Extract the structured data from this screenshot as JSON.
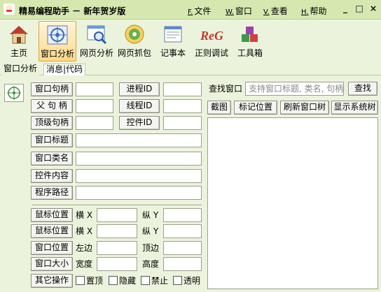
{
  "window": {
    "title": "精易编程助手 － 新年贺岁版",
    "menus": [
      {
        "key": "F.",
        "label": "文件"
      },
      {
        "key": "W.",
        "label": "窗口"
      },
      {
        "key": "V.",
        "label": "查看"
      },
      {
        "key": "H.",
        "label": "帮助"
      }
    ],
    "controls": {
      "minimize": "_",
      "maximize": "□",
      "close": "×"
    }
  },
  "toolbar": {
    "items": [
      {
        "label": "主页",
        "icon": "house-icon",
        "active": false
      },
      {
        "label": "窗口分析",
        "icon": "target-icon",
        "active": true
      },
      {
        "label": "网页分析",
        "icon": "webpage-magnifier-icon",
        "active": false
      },
      {
        "label": "网页抓包",
        "icon": "disc-capture-icon",
        "active": false
      },
      {
        "label": "记事本",
        "icon": "notepad-icon",
        "active": false
      },
      {
        "label": "正则调试",
        "icon": "regex-icon",
        "active": false
      },
      {
        "label": "工具箱",
        "icon": "toolbox-blocks-icon",
        "active": false
      }
    ],
    "regex_glyph": "ReG"
  },
  "tabs": [
    "窗口分析",
    "消息|代码"
  ],
  "left": {
    "window_handle_btn": "窗口句柄",
    "parent_handle_btn": "父 句 柄",
    "toplevel_handle_btn": "顶级句柄",
    "window_title_btn": "窗口标题",
    "window_class_btn": "窗口类名",
    "control_content_btn": "控件内容",
    "program_path_btn": "程序路径",
    "process_id_btn": "进程ID",
    "thread_id_btn": "线程ID",
    "control_id_btn": "控件ID",
    "mouse_pos_btn_1": "鼠标位置",
    "mouse_pos_btn_2": "鼠标位置",
    "window_pos_btn": "窗口位置",
    "window_size_btn": "窗口大小",
    "other_ops_btn": "其它操作",
    "horizontal_x": "横 X",
    "vertical_y": "纵 Y",
    "left_edge": "左边",
    "top_edge": "顶边",
    "width": "宽度",
    "height": "高度",
    "checkboxes": [
      "置顶",
      "隐藏",
      "禁止",
      "透明"
    ]
  },
  "right": {
    "find_label": "查找窗口",
    "find_placeholder": "支持窗口标题, 类名, 句柄",
    "find_btn": "查找",
    "screenshot_btn": "截图",
    "mark_pos_btn": "标记位置",
    "refresh_tree_btn": "刷新窗口树",
    "show_system_tree_btn": "显示系统树"
  },
  "colors": {
    "background": "#ecf3dc",
    "titlebar": "#d6e7b0",
    "active_tool": "#ffd98a"
  }
}
